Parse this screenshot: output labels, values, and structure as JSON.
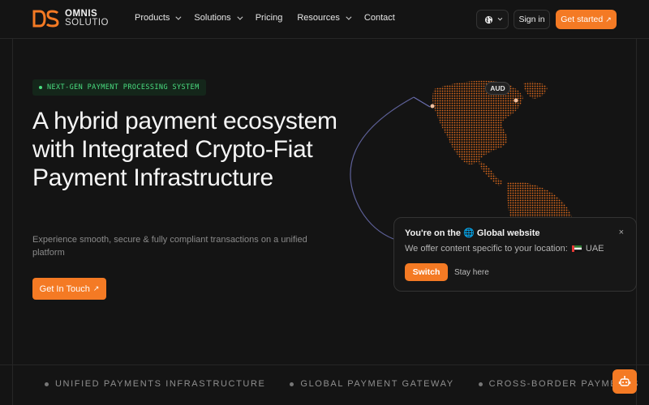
{
  "brand": {
    "name_line1": "OMNIS",
    "name_line2": "SOLUTIO",
    "accent": "#f47a24"
  },
  "nav": {
    "items": [
      {
        "label": "Products",
        "dropdown": true
      },
      {
        "label": "Solutions",
        "dropdown": true
      },
      {
        "label": "Pricing",
        "dropdown": false
      },
      {
        "label": "Resources",
        "dropdown": true
      },
      {
        "label": "Contact",
        "dropdown": false
      }
    ],
    "language_icon": "globe-icon",
    "signin_label": "Sign in",
    "get_started_label": "Get started"
  },
  "hero": {
    "badge": "NEXT-GEN PAYMENT PROCESSING SYSTEM",
    "title": "A hybrid payment ecosystem with Integrated Crypto-Fiat Payment Infrastructure",
    "subtitle": "Experience smooth, secure & fully compliant transactions on a unified platform",
    "cta_label": "Get In Touch"
  },
  "globe": {
    "currency_tag": "AUD"
  },
  "popup": {
    "title_prefix": "You're on the",
    "title_icon": "🌐",
    "title_suffix": "Global website",
    "close": "×",
    "message": "We offer content specific to your location:",
    "location": "UAE",
    "switch_label": "Switch",
    "stay_label": "Stay here"
  },
  "ticker": {
    "items": [
      "UNIFIED PAYMENTS INFRASTRUCTURE",
      "GLOBAL PAYMENT GATEWAY",
      "CROSS-BORDER PAYMENTS"
    ]
  },
  "chatbot": {
    "icon": "robot-icon"
  }
}
